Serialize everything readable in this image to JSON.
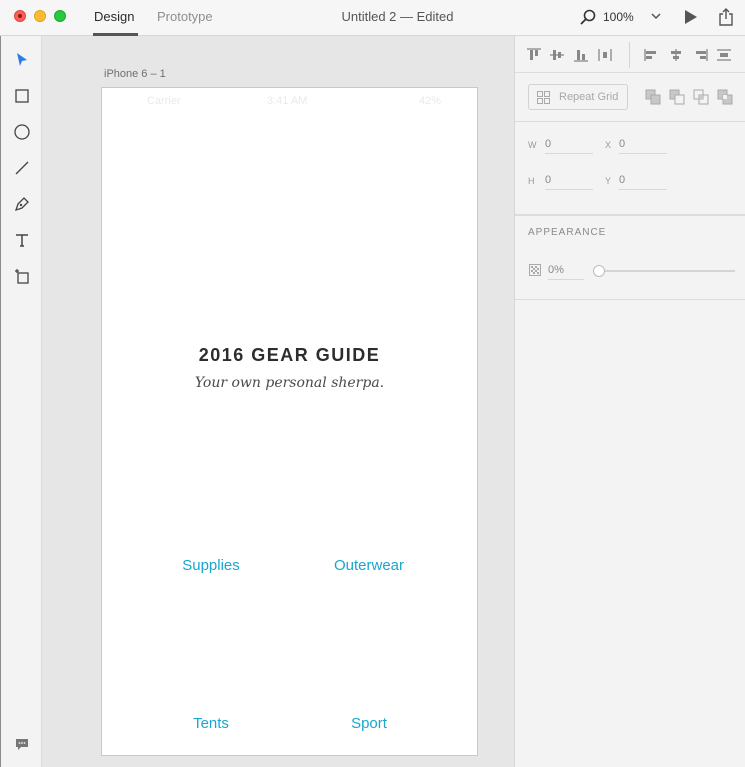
{
  "window": {
    "tabs": [
      {
        "label": "Design",
        "active": true
      },
      {
        "label": "Prototype",
        "active": false
      }
    ],
    "document_title": "Untitled 2 — Edited",
    "zoom": "100%"
  },
  "tools": [
    "select-tool",
    "rectangle-tool",
    "ellipse-tool",
    "line-tool",
    "pen-tool",
    "text-tool",
    "artboard-tool"
  ],
  "artboard": {
    "name": "iPhone 6 – 1",
    "status_bar": {
      "carrier": "Carrier",
      "time": "3:41 AM",
      "battery": "42%"
    },
    "title": "2016 GEAR GUIDE",
    "subtitle": "Your own personal sherpa.",
    "links": [
      "Supplies",
      "Outerwear",
      "Tents",
      "Sport"
    ],
    "accent_color": "#19a6cf"
  },
  "inspector": {
    "repeat_grid": "Repeat Grid",
    "fields": {
      "w": {
        "label": "W",
        "value": "0"
      },
      "x": {
        "label": "X",
        "value": "0"
      },
      "h": {
        "label": "H",
        "value": "0"
      },
      "y": {
        "label": "Y",
        "value": "0"
      }
    },
    "appearance": {
      "label": "APPEARANCE",
      "opacity": "0%"
    }
  }
}
